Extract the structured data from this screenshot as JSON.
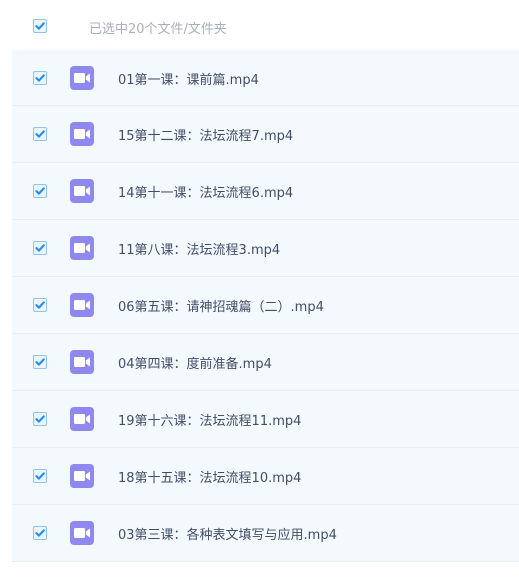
{
  "header": {
    "selection_summary": "已选中20个文件/文件夹"
  },
  "files": [
    {
      "name": "01第一课：课前篇.mp4",
      "selected": true,
      "icon": "video-file-icon"
    },
    {
      "name": "15第十二课：法坛流程7.mp4",
      "selected": true,
      "icon": "video-file-icon"
    },
    {
      "name": "14第十一课：法坛流程6.mp4",
      "selected": true,
      "icon": "video-file-icon"
    },
    {
      "name": "11第八课：法坛流程3.mp4",
      "selected": true,
      "icon": "video-file-icon"
    },
    {
      "name": "06第五课：请神招魂篇（二）.mp4",
      "selected": true,
      "icon": "video-file-icon"
    },
    {
      "name": "04第四课：度前准备.mp4",
      "selected": true,
      "icon": "video-file-icon"
    },
    {
      "name": "19第十六课：法坛流程11.mp4",
      "selected": true,
      "icon": "video-file-icon"
    },
    {
      "name": "18第十五课：法坛流程10.mp4",
      "selected": true,
      "icon": "video-file-icon"
    },
    {
      "name": "03第三课：各种表文填写与应用.mp4",
      "selected": true,
      "icon": "video-file-icon"
    }
  ],
  "colors": {
    "accent": "#2d8ce8",
    "video_icon": "#8e88ef",
    "row_background": "#f4f9fe",
    "text": "#424e67",
    "muted_text": "#a9b0bb"
  }
}
